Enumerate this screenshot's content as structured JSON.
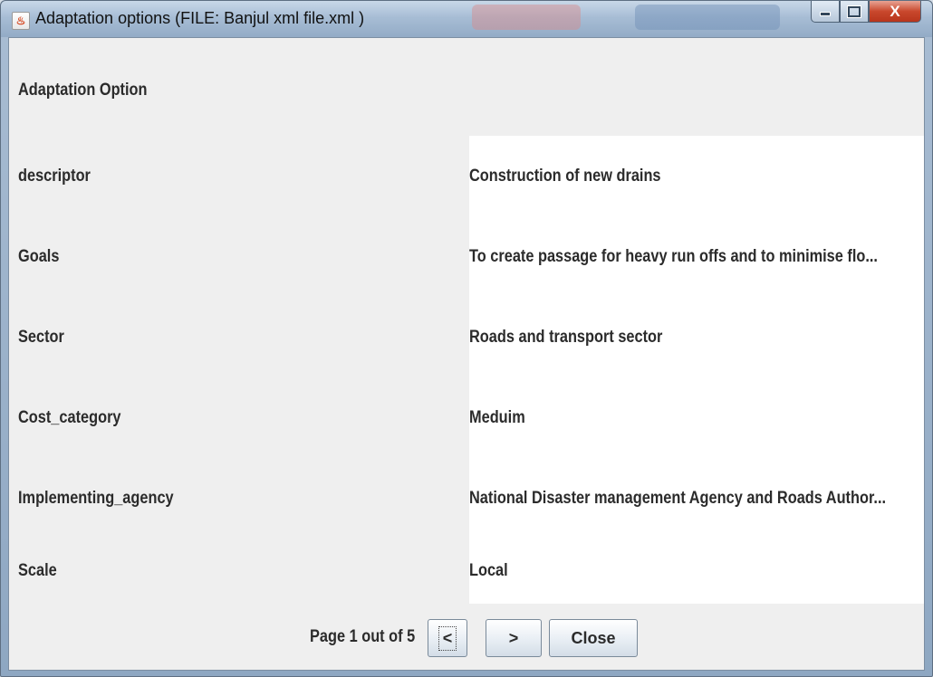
{
  "window": {
    "title": "Adaptation options  (FILE: Banjul xml file.xml )",
    "icon": "java-icon"
  },
  "section": {
    "heading": "Adaptation Option"
  },
  "fields": [
    {
      "label": "descriptor",
      "value": "Construction of new drains"
    },
    {
      "label": "Goals",
      "value": "To create passage for heavy run offs and to minimise flo..."
    },
    {
      "label": "Sector",
      "value": "Roads and transport sector"
    },
    {
      "label": "Cost_category",
      "value": "Meduim"
    },
    {
      "label": "Implementing_agency",
      "value": "National Disaster management Agency and Roads Author..."
    },
    {
      "label": "Scale",
      "value": "Local"
    }
  ],
  "footer": {
    "page_info": "Page 1 out of 5",
    "prev_label": "<",
    "next_label": ">",
    "close_label": "Close"
  },
  "colors": {
    "panel_bg": "#efefef",
    "value_bg": "#ffffff",
    "close_button": "#c9482d"
  }
}
